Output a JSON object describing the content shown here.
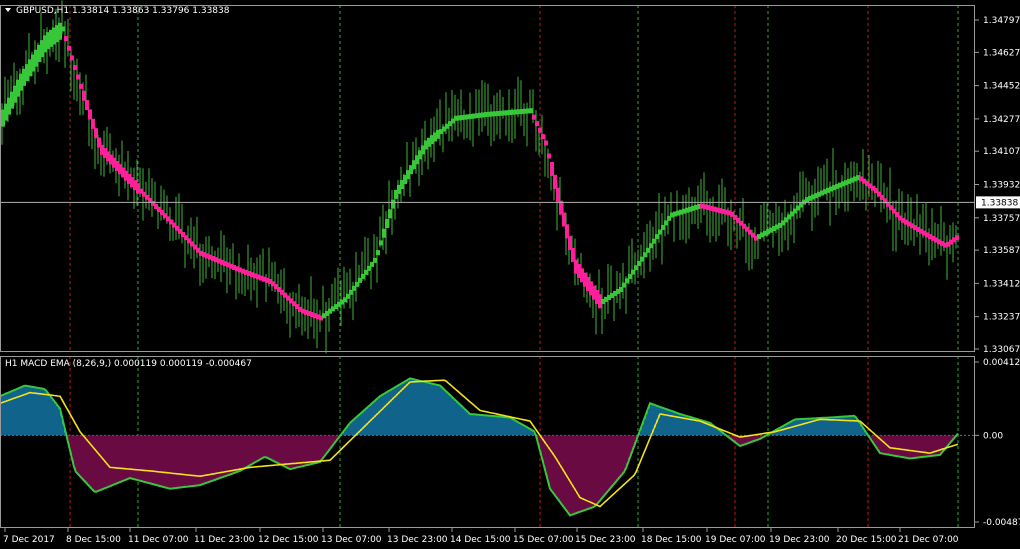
{
  "header": {
    "symbol_line": "GBPUSD,H1  1.33814 1.33863 1.33796 1.33838"
  },
  "indicator": {
    "label": "H1 MACD EMA (8,26,9,) 0.000119 0.000119 -0.000467"
  },
  "colors": {
    "background": "#000000",
    "grid_green": "#2fa83a",
    "grid_red": "#c01818",
    "bar_green": "#39c73a",
    "bar_pink": "#ff1f9a",
    "hist_blue": "#1aa6e8",
    "hist_magenta": "#b0126e",
    "macd_line": "#39c73a",
    "signal_line": "#f2e21a",
    "text": "#ffffff"
  },
  "chart_data": [
    {
      "type": "candlestick",
      "symbol": "GBPUSD",
      "timeframe": "H1",
      "current_price": "1.33838",
      "ylim": [
        1.33067,
        1.34797
      ],
      "y_ticks": [
        "1.34797",
        "1.34627",
        "1.34452",
        "1.34277",
        "1.34107",
        "1.33932",
        "1.33757",
        "1.33587",
        "1.33412",
        "1.33237",
        "1.33067"
      ],
      "x_ticks": [
        "7 Dec 2017",
        "8 Dec 15:00",
        "11 Dec 07:00",
        "11 Dec 23:00",
        "12 Dec 15:00",
        "13 Dec 07:00",
        "13 Dec 23:00",
        "14 Dec 15:00",
        "15 Dec 07:00",
        "15 Dec 23:00",
        "18 Dec 15:00",
        "19 Dec 07:00",
        "19 Dec 23:00",
        "20 Dec 15:00",
        "21 Dec 07:00"
      ],
      "trend_path": [
        {
          "x": 0,
          "y": 1.3426,
          "trend": "up"
        },
        {
          "x": 20,
          "y": 1.3447,
          "trend": "up"
        },
        {
          "x": 45,
          "y": 1.3468,
          "trend": "up"
        },
        {
          "x": 62,
          "y": 1.3475,
          "trend": "up"
        },
        {
          "x": 75,
          "y": 1.3453,
          "trend": "down"
        },
        {
          "x": 100,
          "y": 1.3412,
          "trend": "down"
        },
        {
          "x": 130,
          "y": 1.3395,
          "trend": "down"
        },
        {
          "x": 160,
          "y": 1.3379,
          "trend": "down"
        },
        {
          "x": 200,
          "y": 1.3357,
          "trend": "down"
        },
        {
          "x": 240,
          "y": 1.3348,
          "trend": "down"
        },
        {
          "x": 270,
          "y": 1.3342,
          "trend": "down"
        },
        {
          "x": 300,
          "y": 1.3327,
          "trend": "down"
        },
        {
          "x": 320,
          "y": 1.3323,
          "trend": "down"
        },
        {
          "x": 345,
          "y": 1.3333,
          "trend": "up"
        },
        {
          "x": 375,
          "y": 1.3354,
          "trend": "up"
        },
        {
          "x": 395,
          "y": 1.3388,
          "trend": "up"
        },
        {
          "x": 425,
          "y": 1.3414,
          "trend": "up"
        },
        {
          "x": 455,
          "y": 1.3428,
          "trend": "up"
        },
        {
          "x": 485,
          "y": 1.343,
          "trend": "up"
        },
        {
          "x": 530,
          "y": 1.3432,
          "trend": "up"
        },
        {
          "x": 545,
          "y": 1.3415,
          "trend": "down"
        },
        {
          "x": 560,
          "y": 1.3381,
          "trend": "down"
        },
        {
          "x": 575,
          "y": 1.335,
          "trend": "down"
        },
        {
          "x": 600,
          "y": 1.3331,
          "trend": "down"
        },
        {
          "x": 620,
          "y": 1.3338,
          "trend": "up"
        },
        {
          "x": 645,
          "y": 1.3357,
          "trend": "up"
        },
        {
          "x": 670,
          "y": 1.3377,
          "trend": "up"
        },
        {
          "x": 700,
          "y": 1.3382,
          "trend": "up"
        },
        {
          "x": 730,
          "y": 1.3378,
          "trend": "down"
        },
        {
          "x": 755,
          "y": 1.3365,
          "trend": "down"
        },
        {
          "x": 780,
          "y": 1.3372,
          "trend": "up"
        },
        {
          "x": 805,
          "y": 1.3385,
          "trend": "up"
        },
        {
          "x": 835,
          "y": 1.3392,
          "trend": "up"
        },
        {
          "x": 858,
          "y": 1.3397,
          "trend": "up"
        },
        {
          "x": 875,
          "y": 1.339,
          "trend": "down"
        },
        {
          "x": 900,
          "y": 1.3375,
          "trend": "down"
        },
        {
          "x": 925,
          "y": 1.3367,
          "trend": "down"
        },
        {
          "x": 945,
          "y": 1.3361,
          "trend": "down"
        },
        {
          "x": 958,
          "y": 1.3366,
          "trend": "down"
        }
      ]
    },
    {
      "type": "macd",
      "params": [
        8,
        26,
        9
      ],
      "ylim": [
        -0.004872,
        0.004122
      ],
      "y_ticks": [
        "0.004122",
        "0.00",
        "-0.004872"
      ],
      "macd": [
        {
          "x": 0,
          "v": 0.0022
        },
        {
          "x": 25,
          "v": 0.0028
        },
        {
          "x": 45,
          "v": 0.0026
        },
        {
          "x": 60,
          "v": 0.0015
        },
        {
          "x": 75,
          "v": -0.002
        },
        {
          "x": 95,
          "v": -0.0032
        },
        {
          "x": 130,
          "v": -0.0024
        },
        {
          "x": 170,
          "v": -0.003
        },
        {
          "x": 200,
          "v": -0.0028
        },
        {
          "x": 240,
          "v": -0.002
        },
        {
          "x": 265,
          "v": -0.0012
        },
        {
          "x": 290,
          "v": -0.0019
        },
        {
          "x": 320,
          "v": -0.0015
        },
        {
          "x": 350,
          "v": 0.0007
        },
        {
          "x": 380,
          "v": 0.0022
        },
        {
          "x": 410,
          "v": 0.0032
        },
        {
          "x": 440,
          "v": 0.0028
        },
        {
          "x": 470,
          "v": 0.0012
        },
        {
          "x": 510,
          "v": 0.001
        },
        {
          "x": 535,
          "v": 0.0002
        },
        {
          "x": 550,
          "v": -0.003
        },
        {
          "x": 570,
          "v": -0.0045
        },
        {
          "x": 595,
          "v": -0.004
        },
        {
          "x": 625,
          "v": -0.002
        },
        {
          "x": 650,
          "v": 0.0018
        },
        {
          "x": 680,
          "v": 0.0012
        },
        {
          "x": 710,
          "v": 0.0007
        },
        {
          "x": 740,
          "v": -0.0006
        },
        {
          "x": 760,
          "v": -0.0002
        },
        {
          "x": 795,
          "v": 0.0009
        },
        {
          "x": 830,
          "v": 0.001
        },
        {
          "x": 855,
          "v": 0.0011
        },
        {
          "x": 880,
          "v": -0.001
        },
        {
          "x": 910,
          "v": -0.0013
        },
        {
          "x": 940,
          "v": -0.0011
        },
        {
          "x": 958,
          "v": 0.0001
        }
      ],
      "signal": [
        {
          "x": 0,
          "v": 0.0018
        },
        {
          "x": 30,
          "v": 0.0024
        },
        {
          "x": 60,
          "v": 0.0022
        },
        {
          "x": 80,
          "v": 0.0002
        },
        {
          "x": 110,
          "v": -0.0018
        },
        {
          "x": 150,
          "v": -0.002
        },
        {
          "x": 200,
          "v": -0.0023
        },
        {
          "x": 250,
          "v": -0.0018
        },
        {
          "x": 290,
          "v": -0.0016
        },
        {
          "x": 330,
          "v": -0.0014
        },
        {
          "x": 370,
          "v": 0.0008
        },
        {
          "x": 410,
          "v": 0.003
        },
        {
          "x": 445,
          "v": 0.0031
        },
        {
          "x": 480,
          "v": 0.0014
        },
        {
          "x": 530,
          "v": 0.0008
        },
        {
          "x": 555,
          "v": -0.0012
        },
        {
          "x": 580,
          "v": -0.0035
        },
        {
          "x": 600,
          "v": -0.004
        },
        {
          "x": 635,
          "v": -0.0022
        },
        {
          "x": 660,
          "v": 0.0012
        },
        {
          "x": 700,
          "v": 0.0008
        },
        {
          "x": 740,
          "v": -0.0001
        },
        {
          "x": 775,
          "v": 0.0002
        },
        {
          "x": 820,
          "v": 0.0009
        },
        {
          "x": 860,
          "v": 0.0008
        },
        {
          "x": 890,
          "v": -0.0007
        },
        {
          "x": 930,
          "v": -0.001
        },
        {
          "x": 958,
          "v": -0.0005
        }
      ]
    }
  ]
}
